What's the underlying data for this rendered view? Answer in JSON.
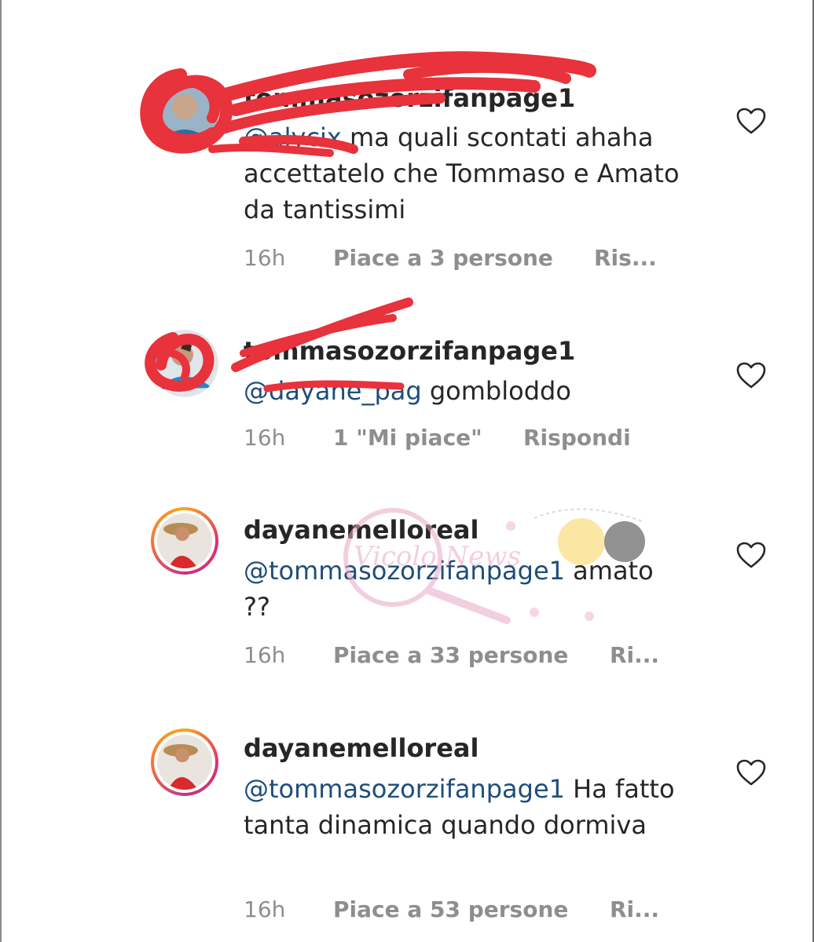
{
  "comments": [
    {
      "username": "tommasozorzifanpage1",
      "mention": "@alycix",
      "text": " ma quali scontati ahaha accettatelo che Tommaso e Amato da tantissimi",
      "time": "16h",
      "likes": "Piace a 3 persone",
      "reply": "Ris..."
    },
    {
      "username": "tommasozorzifanpage1",
      "mention": "@dayane_pag",
      "text": " gombloddo",
      "time": "16h",
      "likes": "1 \"Mi piace\"",
      "reply": "Rispondi"
    },
    {
      "username": "dayanemelloreal",
      "mention": "@tommasozorzifanpage1",
      "text": " amato ??",
      "time": "16h",
      "likes": "Piace a 33 persone",
      "reply": "Ri..."
    },
    {
      "username": "dayanemelloreal",
      "mention": "@tommasozorzifanpage1",
      "text": " Ha fatto tanta dinamica quando dormiva",
      "time": "16h",
      "likes": "Piace a 53 persone",
      "reply": "Ri..."
    }
  ],
  "watermark": "Vicolo News",
  "icons": {
    "like": "heart-outline-icon"
  },
  "colors": {
    "mention": "#1e4d7b",
    "meta": "#8e8e8e",
    "scribble": "#e8323c"
  }
}
